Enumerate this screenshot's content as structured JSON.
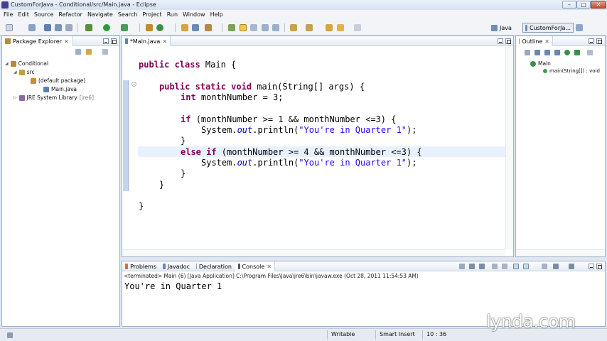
{
  "window": {
    "title": "CustomForJava - Conditional/src/Main.java - Eclipse",
    "controls": {
      "minimize": "–",
      "maximize": "□",
      "close": "✕"
    }
  },
  "menubar": {
    "items": [
      "File",
      "Edit",
      "Source",
      "Refactor",
      "Navigate",
      "Search",
      "Project",
      "Run",
      "Window",
      "Help"
    ]
  },
  "perspectives": {
    "java": "Java",
    "custom": "CustomForJa..."
  },
  "package_explorer": {
    "tab_label": "Package Explorer",
    "tree": {
      "project": "Conditional",
      "src": "src",
      "package": "(default package)",
      "file": "Main.java",
      "jre": "JRE System Library",
      "jre_tag": "[jre6]"
    }
  },
  "editor": {
    "tab_label": "*Main.java",
    "code": {
      "l1_kw": "public class ",
      "l1_rest": "Main {",
      "l2_kw": "public static void ",
      "l2_rest": "main(String[] args) {",
      "l3_kw": "int ",
      "l3_rest": "monthNumber = 3;",
      "l4_kw": "if ",
      "l4_rest": "(monthNumber >= 1 && monthNumber <=3) {",
      "print_a": "System.",
      "print_b": "out",
      "print_c": ".println(",
      "print_str": "\"You're in Quarter 1\"",
      "print_d": ");",
      "brace_close": "}",
      "l6_kw": "else if ",
      "l6_rest": "(monthNumber >= 4 && monthNumber <=3) {"
    }
  },
  "outline": {
    "tab_label": "Outline",
    "class_name": "Main",
    "method": "main(String[]) : void"
  },
  "console": {
    "tabs": [
      "Problems",
      "Javadoc",
      "Declaration",
      "Console"
    ],
    "terminated": "<terminated> Main (6) [Java Application] C:\\Program Files\\Java\\jre6\\bin\\javaw.exe (Oct 28, 2011 11:54:53 AM)",
    "output": "You're in Quarter 1"
  },
  "statusbar": {
    "writable": "Writable",
    "insert_mode": "Smart Insert",
    "position": "10 : 36"
  },
  "watermark": "lynda.com",
  "colors": {
    "keyword": "#7f0055",
    "string": "#2a00ff",
    "field": "#0000c0"
  }
}
